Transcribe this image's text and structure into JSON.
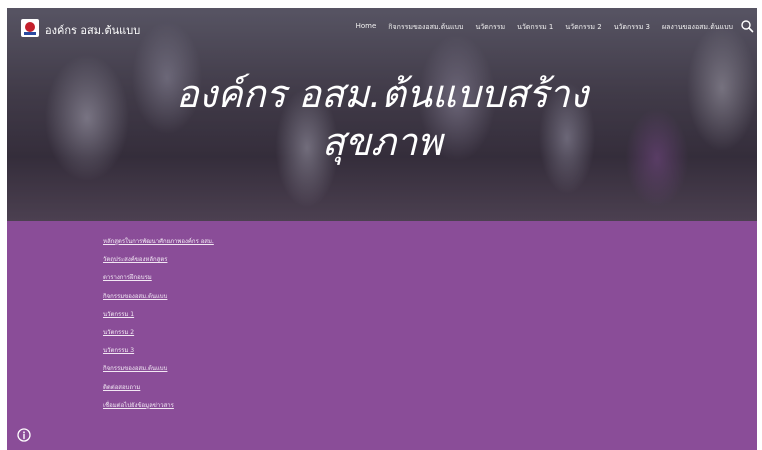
{
  "site": {
    "name": "องค์กร อสม.ต้นแบบ"
  },
  "nav": {
    "items": [
      "Home",
      "กิจกรรมของอสม.ต้นแบบ",
      "นวัตกรรม",
      "นวัตกรรม 1",
      "นวัตกรรม 2",
      "นวัตกรรม 3",
      "ผลงานของอสม.ต้นแบบ"
    ]
  },
  "hero": {
    "title_line1": "องค์กร อสม.ต้นแบบสร้าง",
    "title_line2": "สุขภาพ"
  },
  "links": [
    "หลักสูตรในการพัฒนาศักยภาพองค์กร อสม.",
    "วัตถุประสงค์ของหลักสูตร",
    "ตารางการฝึกอบรม",
    "กิจกรรมของอสม.ต้นแบบ",
    "นวัตกรรม 1",
    "นวัตกรรม 2",
    "นวัตกรรม 3",
    "กิจกรรมของอสม.ต้นแบบ",
    "ติดต่อสอบถาม",
    "เชื่อมต่อไปยังข้อมูลข่าวสาร"
  ],
  "colors": {
    "content_bg": "#8a4d98",
    "link": "#f2e8f4"
  },
  "icons": {
    "search": "search-icon",
    "info": "info-icon",
    "logo": "logo-icon"
  }
}
